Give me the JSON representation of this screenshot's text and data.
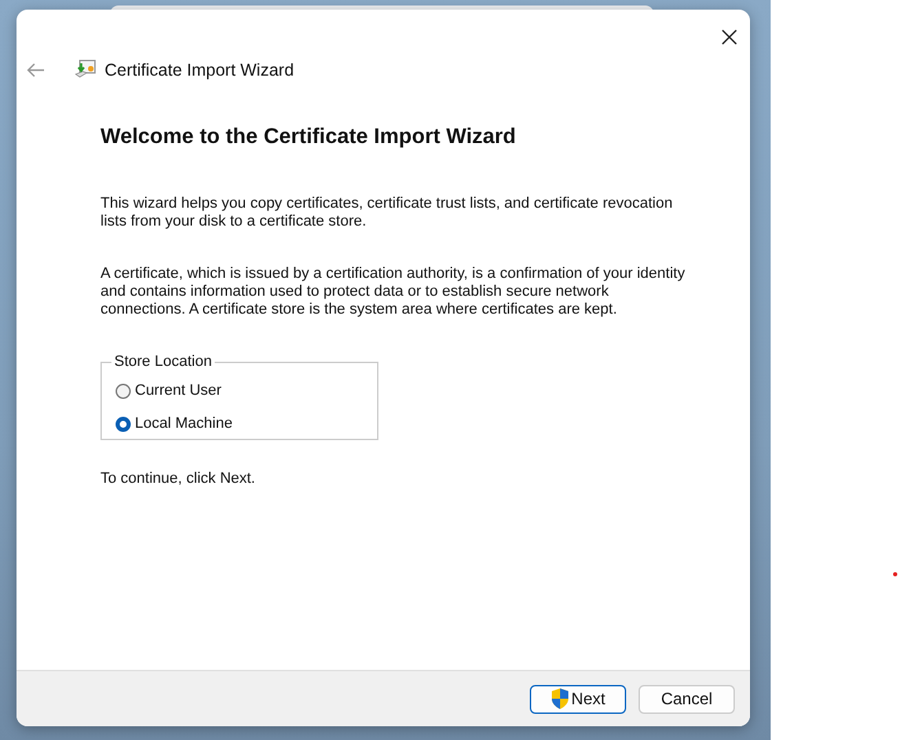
{
  "window": {
    "title": "Certificate Import Wizard"
  },
  "heading": "Welcome to the Certificate Import Wizard",
  "paragraphs": [
    "This wizard helps you copy certificates, certificate trust lists, and certificate revocation lists from your disk to a certificate store.",
    "A certificate, which is issued by a certification authority, is a confirmation of your identity and contains information used to protect data or to establish secure network connections. A certificate store is the system area where certificates are kept."
  ],
  "store_location": {
    "label": "Store Location",
    "options": [
      {
        "label": "Current User",
        "selected": false
      },
      {
        "label": "Local Machine",
        "selected": true
      }
    ]
  },
  "instruction": "To continue, click Next.",
  "buttons": [
    {
      "label": "Next",
      "kind": "primary",
      "shield": true
    },
    {
      "label": "Cancel",
      "kind": "normal",
      "shield": false
    }
  ]
}
